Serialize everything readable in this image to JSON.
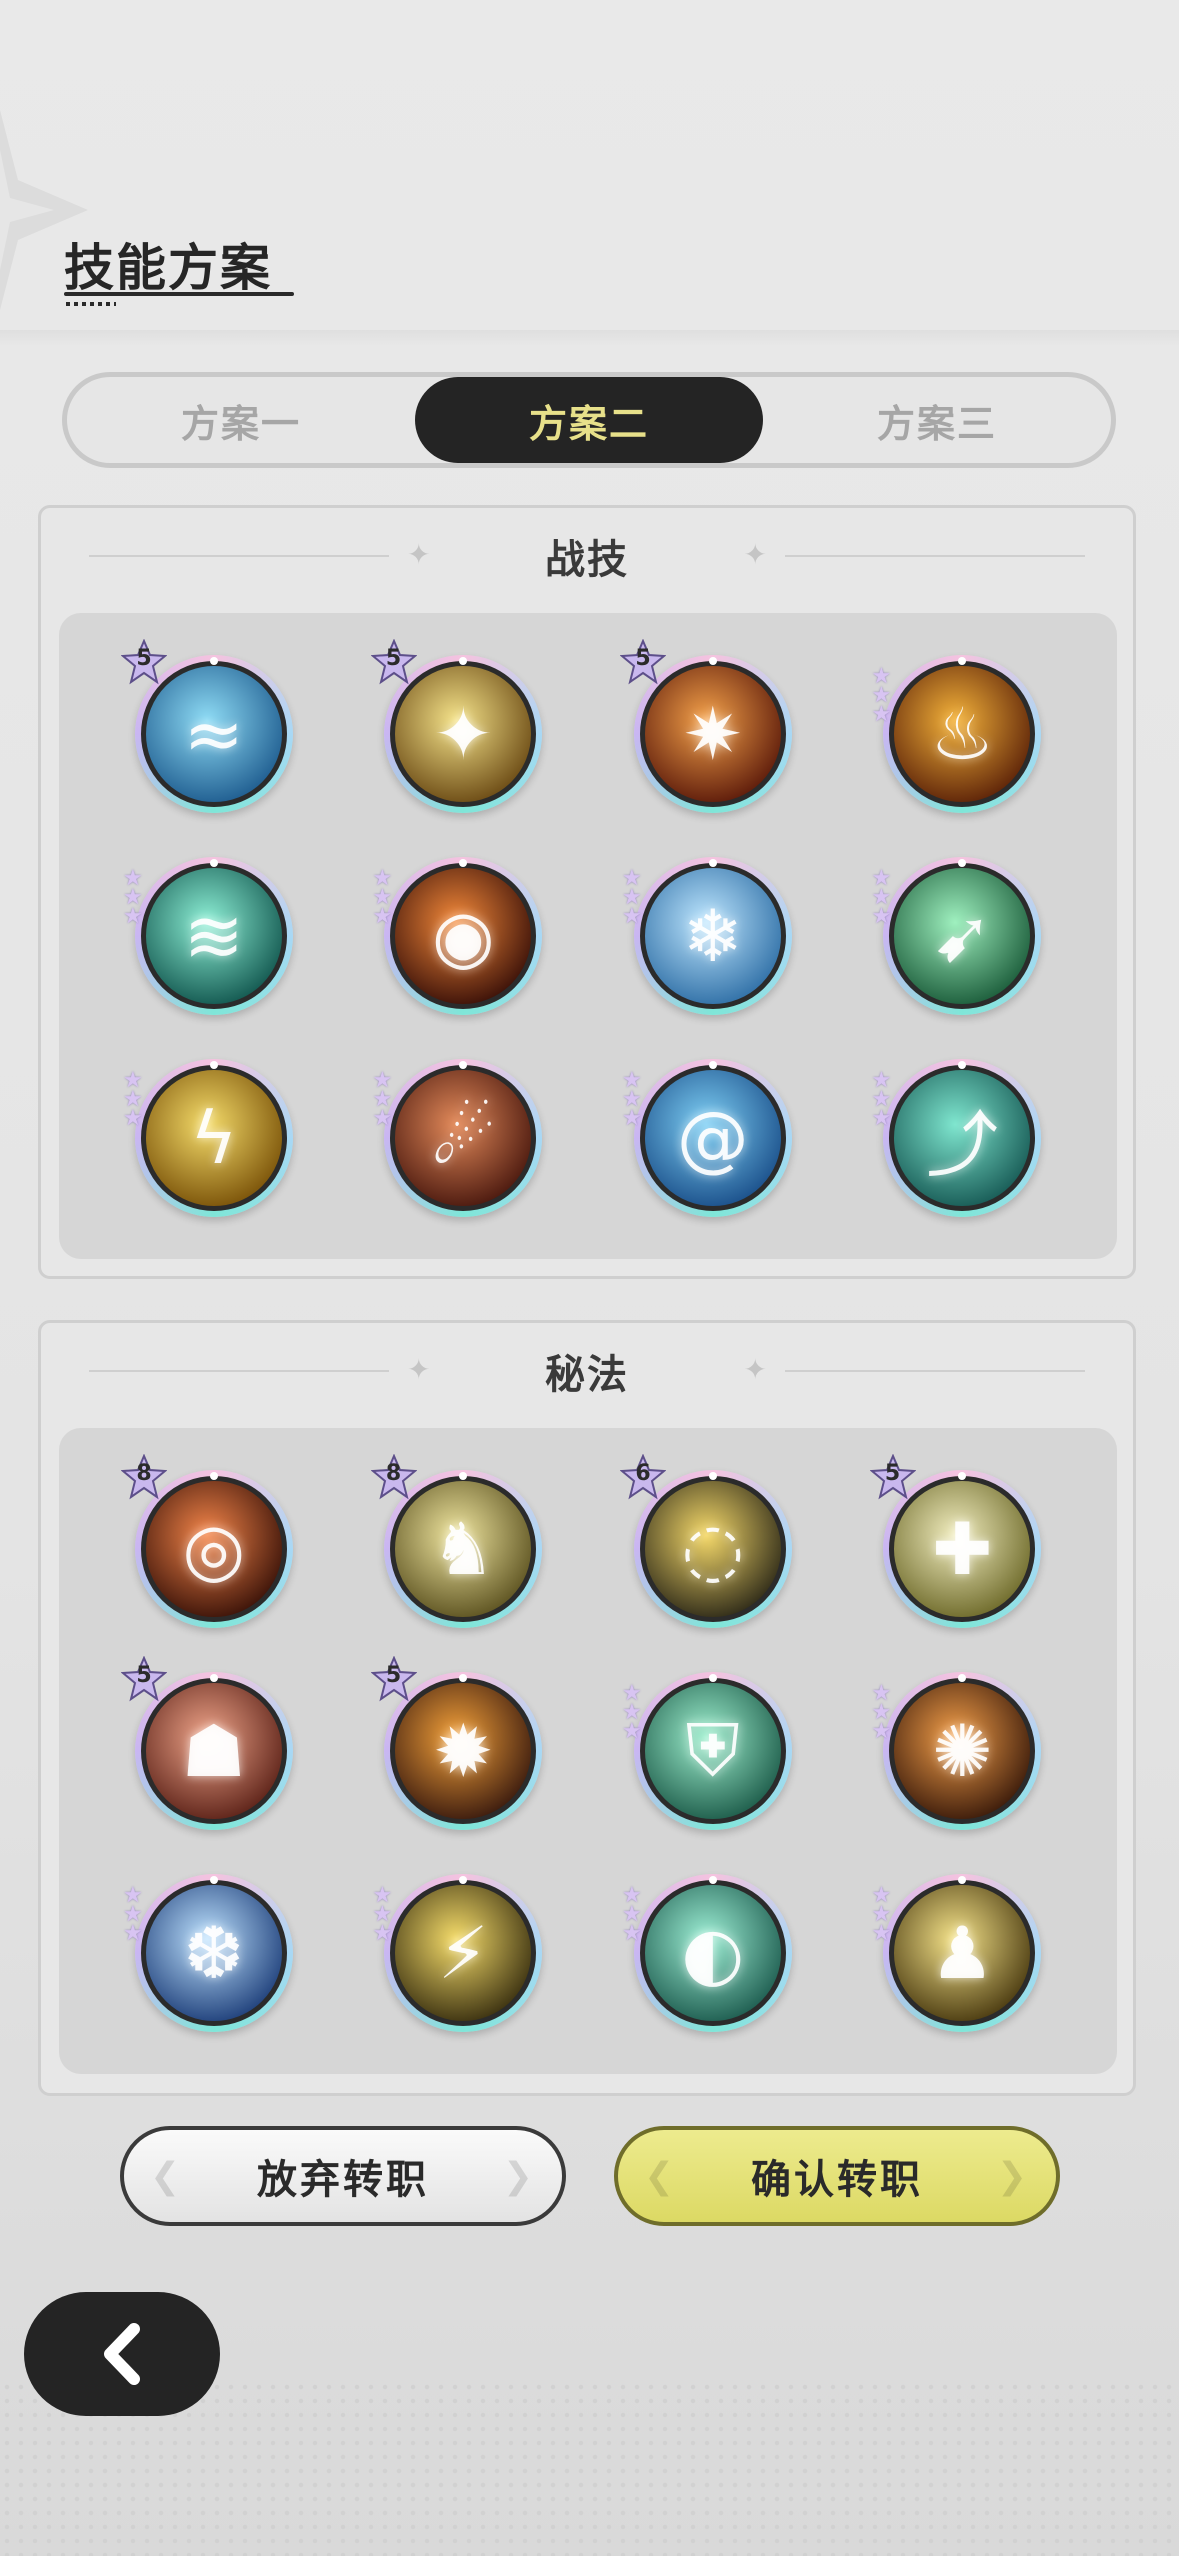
{
  "page": {
    "title": "技能方案"
  },
  "tabs": [
    {
      "label": "方案一",
      "active": false
    },
    {
      "label": "方案二",
      "active": true
    },
    {
      "label": "方案三",
      "active": false
    }
  ],
  "sections": [
    {
      "title": "战技",
      "skills": [
        {
          "icon": "water-wave-icon",
          "glyph": "≈",
          "colors": [
            "#8fdcf5",
            "#1e5c8f"
          ],
          "badge": "5",
          "stars": 0
        },
        {
          "icon": "golden-sparks-icon",
          "glyph": "✦",
          "colors": [
            "#f5e38a",
            "#6b4a14"
          ],
          "badge": "5",
          "stars": 0
        },
        {
          "icon": "fire-swirl-icon",
          "glyph": "✷",
          "colors": [
            "#f5a24a",
            "#5c1a0a"
          ],
          "badge": "5",
          "stars": 0
        },
        {
          "icon": "campfire-icon",
          "glyph": "♨",
          "colors": [
            "#f5b33a",
            "#5c2208"
          ],
          "badge": "",
          "stars": 3
        },
        {
          "icon": "wind-vortex-icon",
          "glyph": "≋",
          "colors": [
            "#8ef0d6",
            "#12574f"
          ],
          "badge": "",
          "stars": 3
        },
        {
          "icon": "fire-orb-icon",
          "glyph": "◉",
          "colors": [
            "#f58a3a",
            "#3a1008"
          ],
          "badge": "",
          "stars": 3
        },
        {
          "icon": "ice-crystal-icon",
          "glyph": "❄",
          "colors": [
            "#bfe7ff",
            "#2f6fa6"
          ],
          "badge": "",
          "stars": 3
        },
        {
          "icon": "wind-blade-icon",
          "glyph": "➹",
          "colors": [
            "#9ff0bf",
            "#1b5c3a"
          ],
          "badge": "",
          "stars": 3
        },
        {
          "icon": "lightning-storm-icon",
          "glyph": "ϟ",
          "colors": [
            "#f5dc6a",
            "#7a5208"
          ],
          "badge": "",
          "stars": 3
        },
        {
          "icon": "meteor-icon",
          "glyph": "☄",
          "colors": [
            "#e38a5a",
            "#4a180e"
          ],
          "badge": "",
          "stars": 3
        },
        {
          "icon": "water-vortex-icon",
          "glyph": "@",
          "colors": [
            "#7fd0f5",
            "#1a4f8a"
          ],
          "badge": "",
          "stars": 3
        },
        {
          "icon": "wind-arrow-icon",
          "glyph": "⤴",
          "colors": [
            "#7fe6cf",
            "#175a55"
          ],
          "badge": "",
          "stars": 3
        }
      ]
    },
    {
      "title": "秘法",
      "skills": [
        {
          "icon": "fire-ring-icon",
          "glyph": "◎",
          "colors": [
            "#f5864a",
            "#3a1208"
          ],
          "badge": "8",
          "stars": 0
        },
        {
          "icon": "golden-warrior-icon",
          "glyph": "♞",
          "colors": [
            "#f0e6a0",
            "#5c5220"
          ],
          "badge": "8",
          "stars": 0
        },
        {
          "icon": "golden-halo-icon",
          "glyph": "◌",
          "colors": [
            "#f5d96a",
            "#2e2a18"
          ],
          "badge": "6",
          "stars": 0
        },
        {
          "icon": "healing-figure-icon",
          "glyph": "✚",
          "colors": [
            "#f2eec0",
            "#6e6a2a"
          ],
          "badge": "5",
          "stars": 0
        },
        {
          "icon": "demon-mask-icon",
          "glyph": "☗",
          "colors": [
            "#f0a58a",
            "#5c2218"
          ],
          "badge": "5",
          "stars": 0
        },
        {
          "icon": "flame-spirit-icon",
          "glyph": "✹",
          "colors": [
            "#f5a23a",
            "#3a1a0e"
          ],
          "badge": "5",
          "stars": 0
        },
        {
          "icon": "shield-icon",
          "glyph": "⛨",
          "colors": [
            "#9ff0cf",
            "#1d5c4a"
          ],
          "badge": "",
          "stars": 3
        },
        {
          "icon": "fire-dash-icon",
          "glyph": "✺",
          "colors": [
            "#f5a04a",
            "#3a1a0a"
          ],
          "badge": "",
          "stars": 3
        },
        {
          "icon": "frost-figure-icon",
          "glyph": "❆",
          "colors": [
            "#bfe3ff",
            "#1e3f7a"
          ],
          "badge": "",
          "stars": 3
        },
        {
          "icon": "thunder-strike-icon",
          "glyph": "⚡",
          "colors": [
            "#f5dc6a",
            "#3a3010"
          ],
          "badge": "",
          "stars": 3
        },
        {
          "icon": "wind-slash-icon",
          "glyph": "◐",
          "colors": [
            "#9ff0d6",
            "#1d5c4f"
          ],
          "badge": "",
          "stars": 3
        },
        {
          "icon": "golden-guardian-icon",
          "glyph": "♟",
          "colors": [
            "#f5e38a",
            "#4a3a10"
          ],
          "badge": "",
          "stars": 3
        }
      ]
    }
  ],
  "buttons": {
    "abandon": "放弃转职",
    "confirm": "确认转职"
  },
  "colors": {
    "accent_tab_text": "#e7e08a",
    "confirm_button": "#dcd964",
    "dark": "#242424"
  }
}
